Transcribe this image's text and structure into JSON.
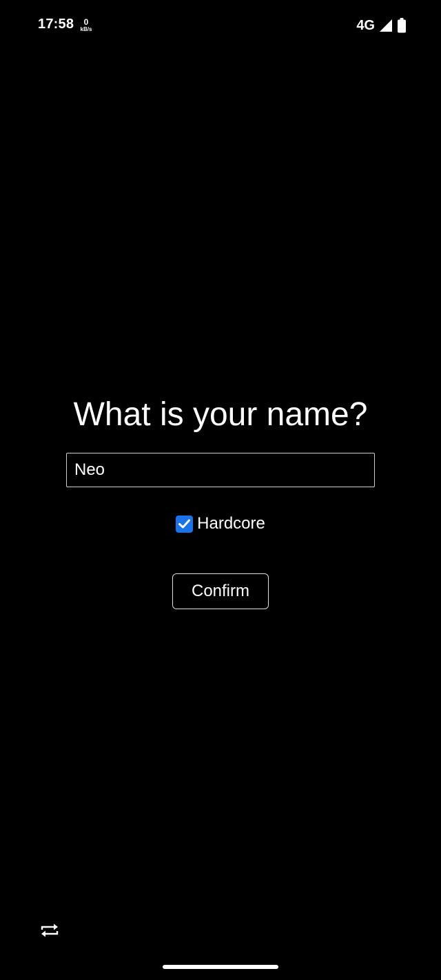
{
  "status_bar": {
    "time": "17:58",
    "net_speed_value": "0",
    "net_speed_unit": "kB/s",
    "network_type": "4G",
    "icons": [
      "signal-icon",
      "battery-icon"
    ]
  },
  "form": {
    "title": "What is your name?",
    "name_value": "Neo",
    "hardcore_label": "Hardcore",
    "hardcore_checked": true,
    "confirm_label": "Confirm"
  },
  "colors": {
    "background": "#000000",
    "text": "#ffffff",
    "checkbox_accent": "#1a73e8"
  },
  "bottom": {
    "icons": [
      "rotate-icon"
    ]
  }
}
